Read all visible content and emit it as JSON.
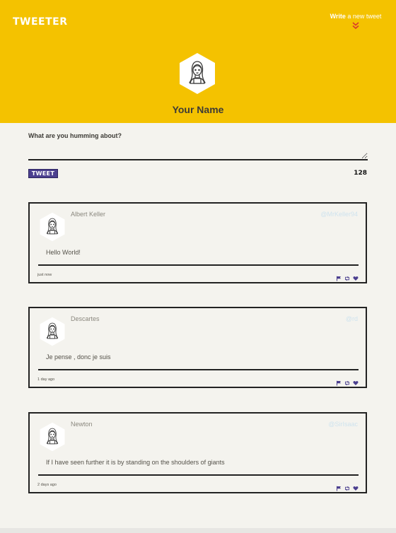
{
  "header": {
    "logo": "TWEETER",
    "write_bold": "Write",
    "write_rest": " a new tweet",
    "user_name": "Your Name"
  },
  "compose": {
    "label": "What are you humming about?",
    "placeholder": "",
    "button_label": "TWEET",
    "counter": "128"
  },
  "colors": {
    "header_bg": "#f4c200",
    "page_bg": "#f4f3ee",
    "accent": "#4b3f8f",
    "chevron": "#d93a2b"
  },
  "tweets": [
    {
      "name": "Albert Keller",
      "handle": "@MrKeller94",
      "text": "Hello World!",
      "time": "just now",
      "icons": [
        "flag-icon",
        "retweet-icon",
        "heart-icon"
      ]
    },
    {
      "name": "Descartes",
      "handle": "@rd",
      "text": "Je pense , donc je suis",
      "time": "1 day ago",
      "icons": [
        "flag-icon",
        "retweet-icon",
        "heart-icon"
      ]
    },
    {
      "name": "Newton",
      "handle": "@SirIsaac",
      "text": "If I have seen further it is by standing on the shoulders of giants",
      "time": "2 days ago",
      "icons": [
        "flag-icon",
        "retweet-icon",
        "heart-icon"
      ]
    }
  ]
}
